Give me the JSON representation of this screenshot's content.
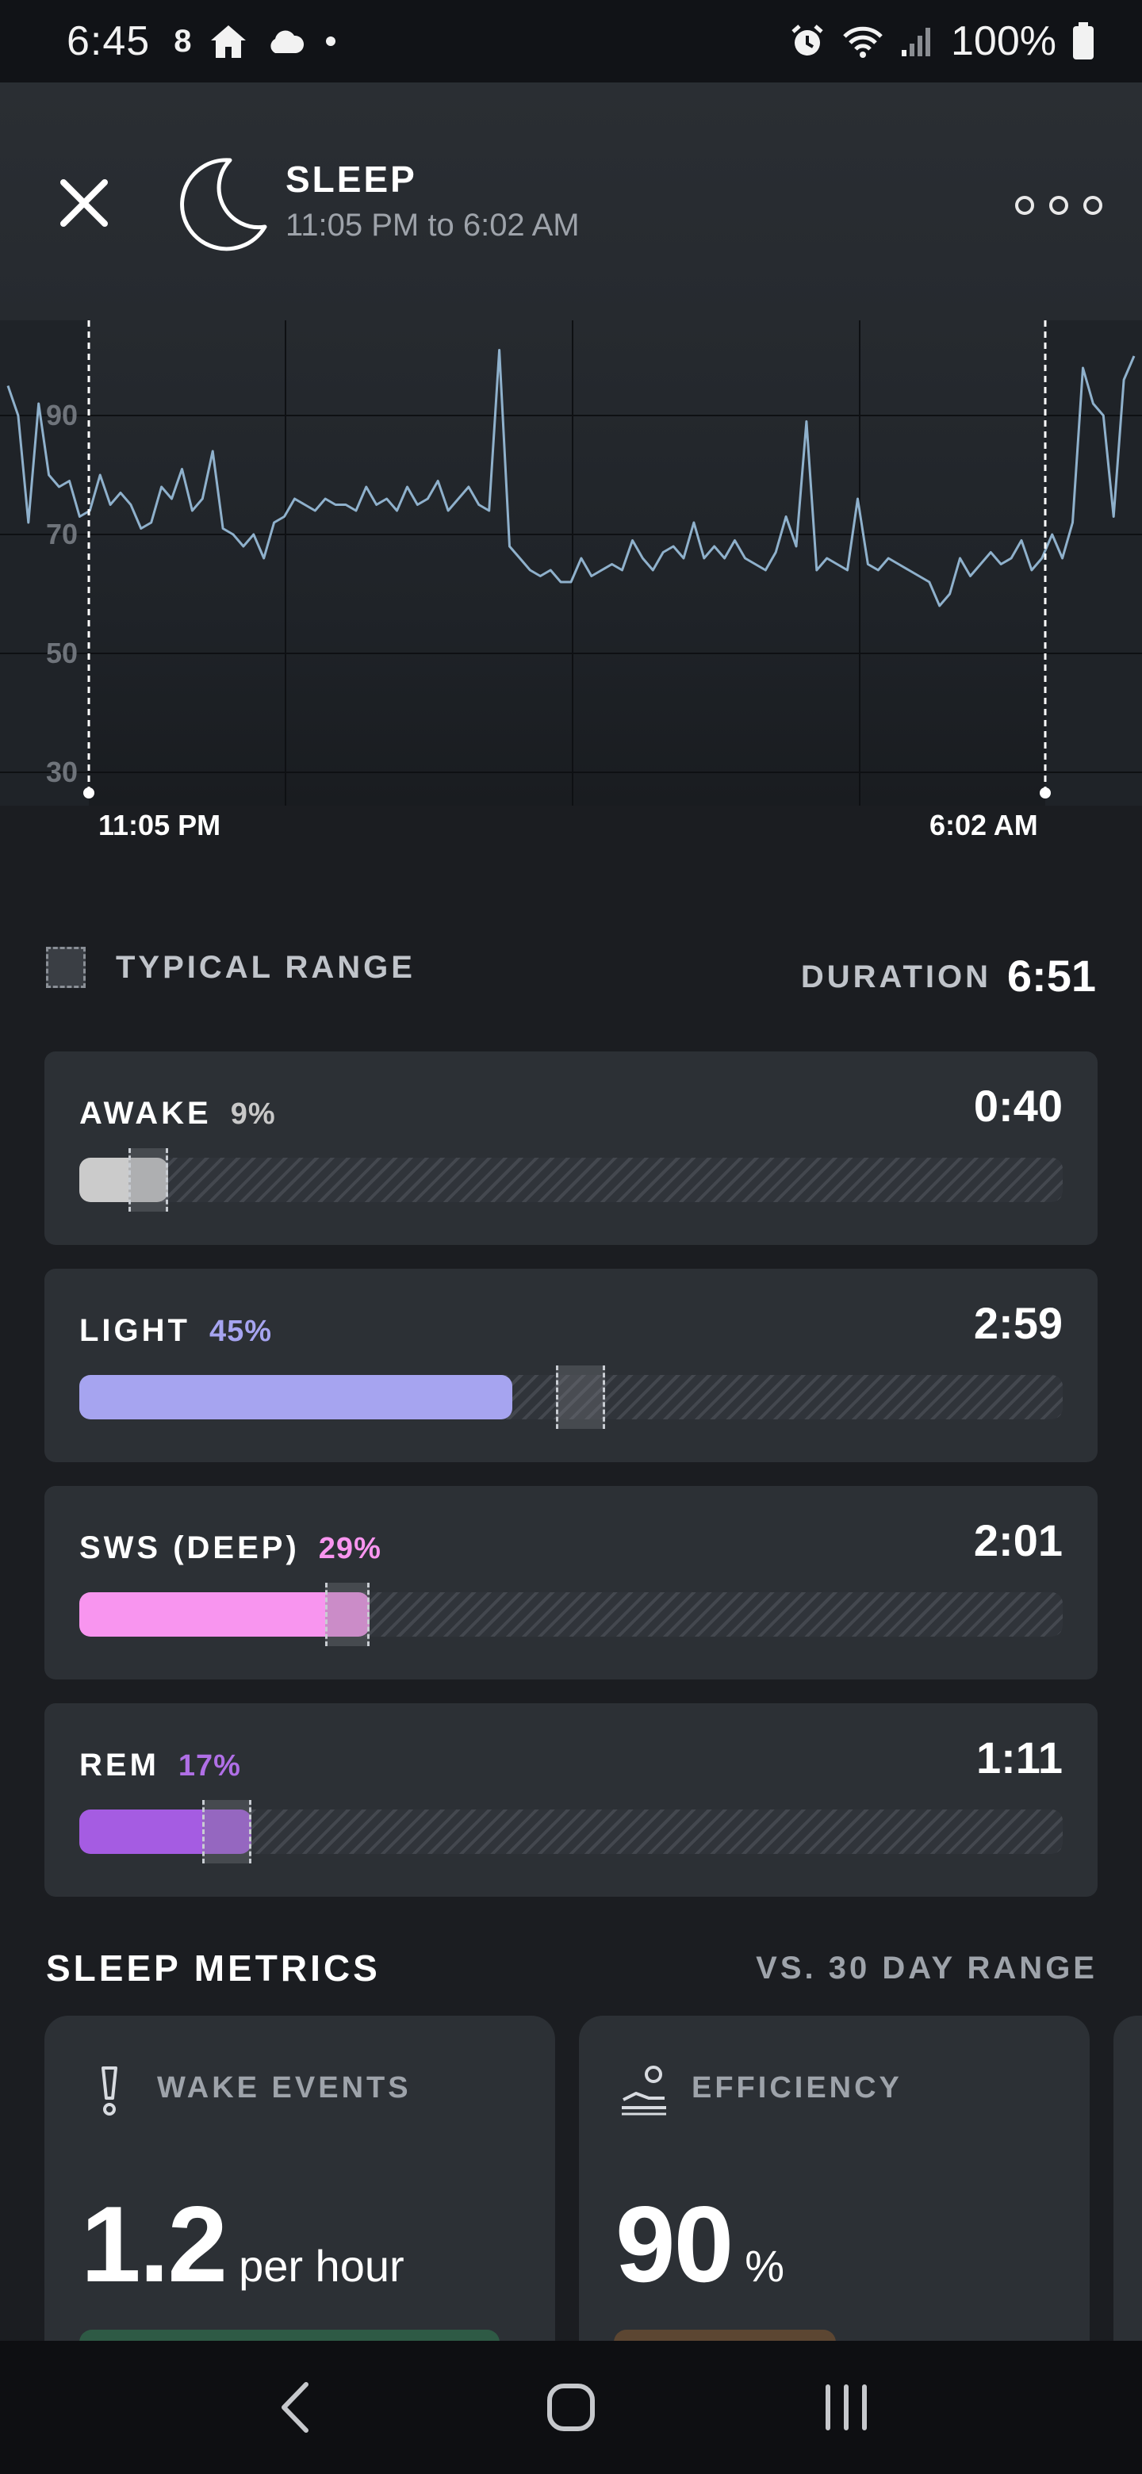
{
  "status_bar": {
    "time": "6:45",
    "left_icons": [
      "8-notification-icon",
      "home-icon",
      "cloud-icon",
      "dot-icon"
    ],
    "right_icons": [
      "alarm-icon",
      "wifi-icon",
      "signal-icon",
      "battery-icon"
    ],
    "battery": "100%"
  },
  "header": {
    "title": "SLEEP",
    "subtitle": "11:05 PM to 6:02 AM",
    "close_icon": "close-icon",
    "activity_icon": "moon-icon",
    "more_icon": "more-options-icon"
  },
  "heart_rate_chart": {
    "y_ticks": [
      "90",
      "70",
      "50",
      "30"
    ],
    "start_label": "11:05 PM",
    "end_label": "6:02 AM"
  },
  "chart_data": {
    "type": "line",
    "title": "",
    "xlabel": "",
    "ylabel": "",
    "ylim": [
      25,
      105
    ],
    "grid": true,
    "series": [
      {
        "values": [
          95,
          90,
          72,
          92,
          80,
          78,
          79,
          73,
          74,
          80,
          75,
          77,
          75,
          71,
          72,
          78,
          76,
          81,
          74,
          76,
          84,
          71,
          70,
          68,
          70,
          66,
          72,
          73,
          76,
          75,
          74,
          76,
          75,
          75,
          74,
          78,
          75,
          76,
          74,
          78,
          75,
          76,
          79,
          74,
          76,
          78,
          75,
          74,
          101,
          68,
          66,
          64,
          63,
          64,
          62,
          62,
          66,
          63,
          64,
          65,
          64,
          69,
          66,
          64,
          67,
          68,
          66,
          72,
          66,
          68,
          66,
          69,
          66,
          65,
          64,
          67,
          73,
          68,
          89,
          64,
          66,
          65,
          64,
          76,
          65,
          64,
          66,
          65,
          64,
          63,
          62,
          58,
          60,
          66,
          63,
          65,
          67,
          65,
          66,
          69,
          64,
          66,
          70,
          66,
          72,
          98,
          92,
          90,
          73,
          96,
          100
        ]
      }
    ]
  },
  "typical_range_label": "TYPICAL RANGE",
  "duration": {
    "label": "DURATION",
    "value": "6:51"
  },
  "stages": [
    {
      "name": "AWAKE",
      "percent": "9%",
      "time": "0:40",
      "fill_fraction": 0.09,
      "typical_start": 0.05,
      "typical_end": 0.09,
      "color": "#cbcbcb",
      "pct_color": "#c8c8c8"
    },
    {
      "name": "LIGHT",
      "percent": "45%",
      "time": "2:59",
      "fill_fraction": 0.44,
      "typical_start": 0.485,
      "typical_end": 0.535,
      "color": "#a6a4f0",
      "pct_color": "#a6a4f0"
    },
    {
      "name": "SWS (DEEP)",
      "percent": "29%",
      "time": "2:01",
      "fill_fraction": 0.295,
      "typical_start": 0.25,
      "typical_end": 0.295,
      "color": "#f895ef",
      "pct_color": "#f895ef"
    },
    {
      "name": "REM",
      "percent": "17%",
      "time": "1:11",
      "fill_fraction": 0.175,
      "typical_start": 0.125,
      "typical_end": 0.175,
      "color": "#a55ce2",
      "pct_color": "#b06fe6"
    }
  ],
  "metrics": {
    "title": "SLEEP METRICS",
    "compare_label": "VS. 30 DAY RANGE",
    "cards": [
      {
        "icon": "exclamation-icon",
        "label": "WAKE EVENTS",
        "value": "1.2",
        "unit": "per hour",
        "pill_color": "#2e5a45"
      },
      {
        "icon": "sleeping-person-icon",
        "label": "EFFICIENCY",
        "value": "90",
        "unit": "%",
        "pill_color": "#5c4632"
      }
    ]
  },
  "nav_bar": {
    "back_icon": "back-icon",
    "home_icon": "home-circle-icon",
    "recents_icon": "recents-icon"
  }
}
